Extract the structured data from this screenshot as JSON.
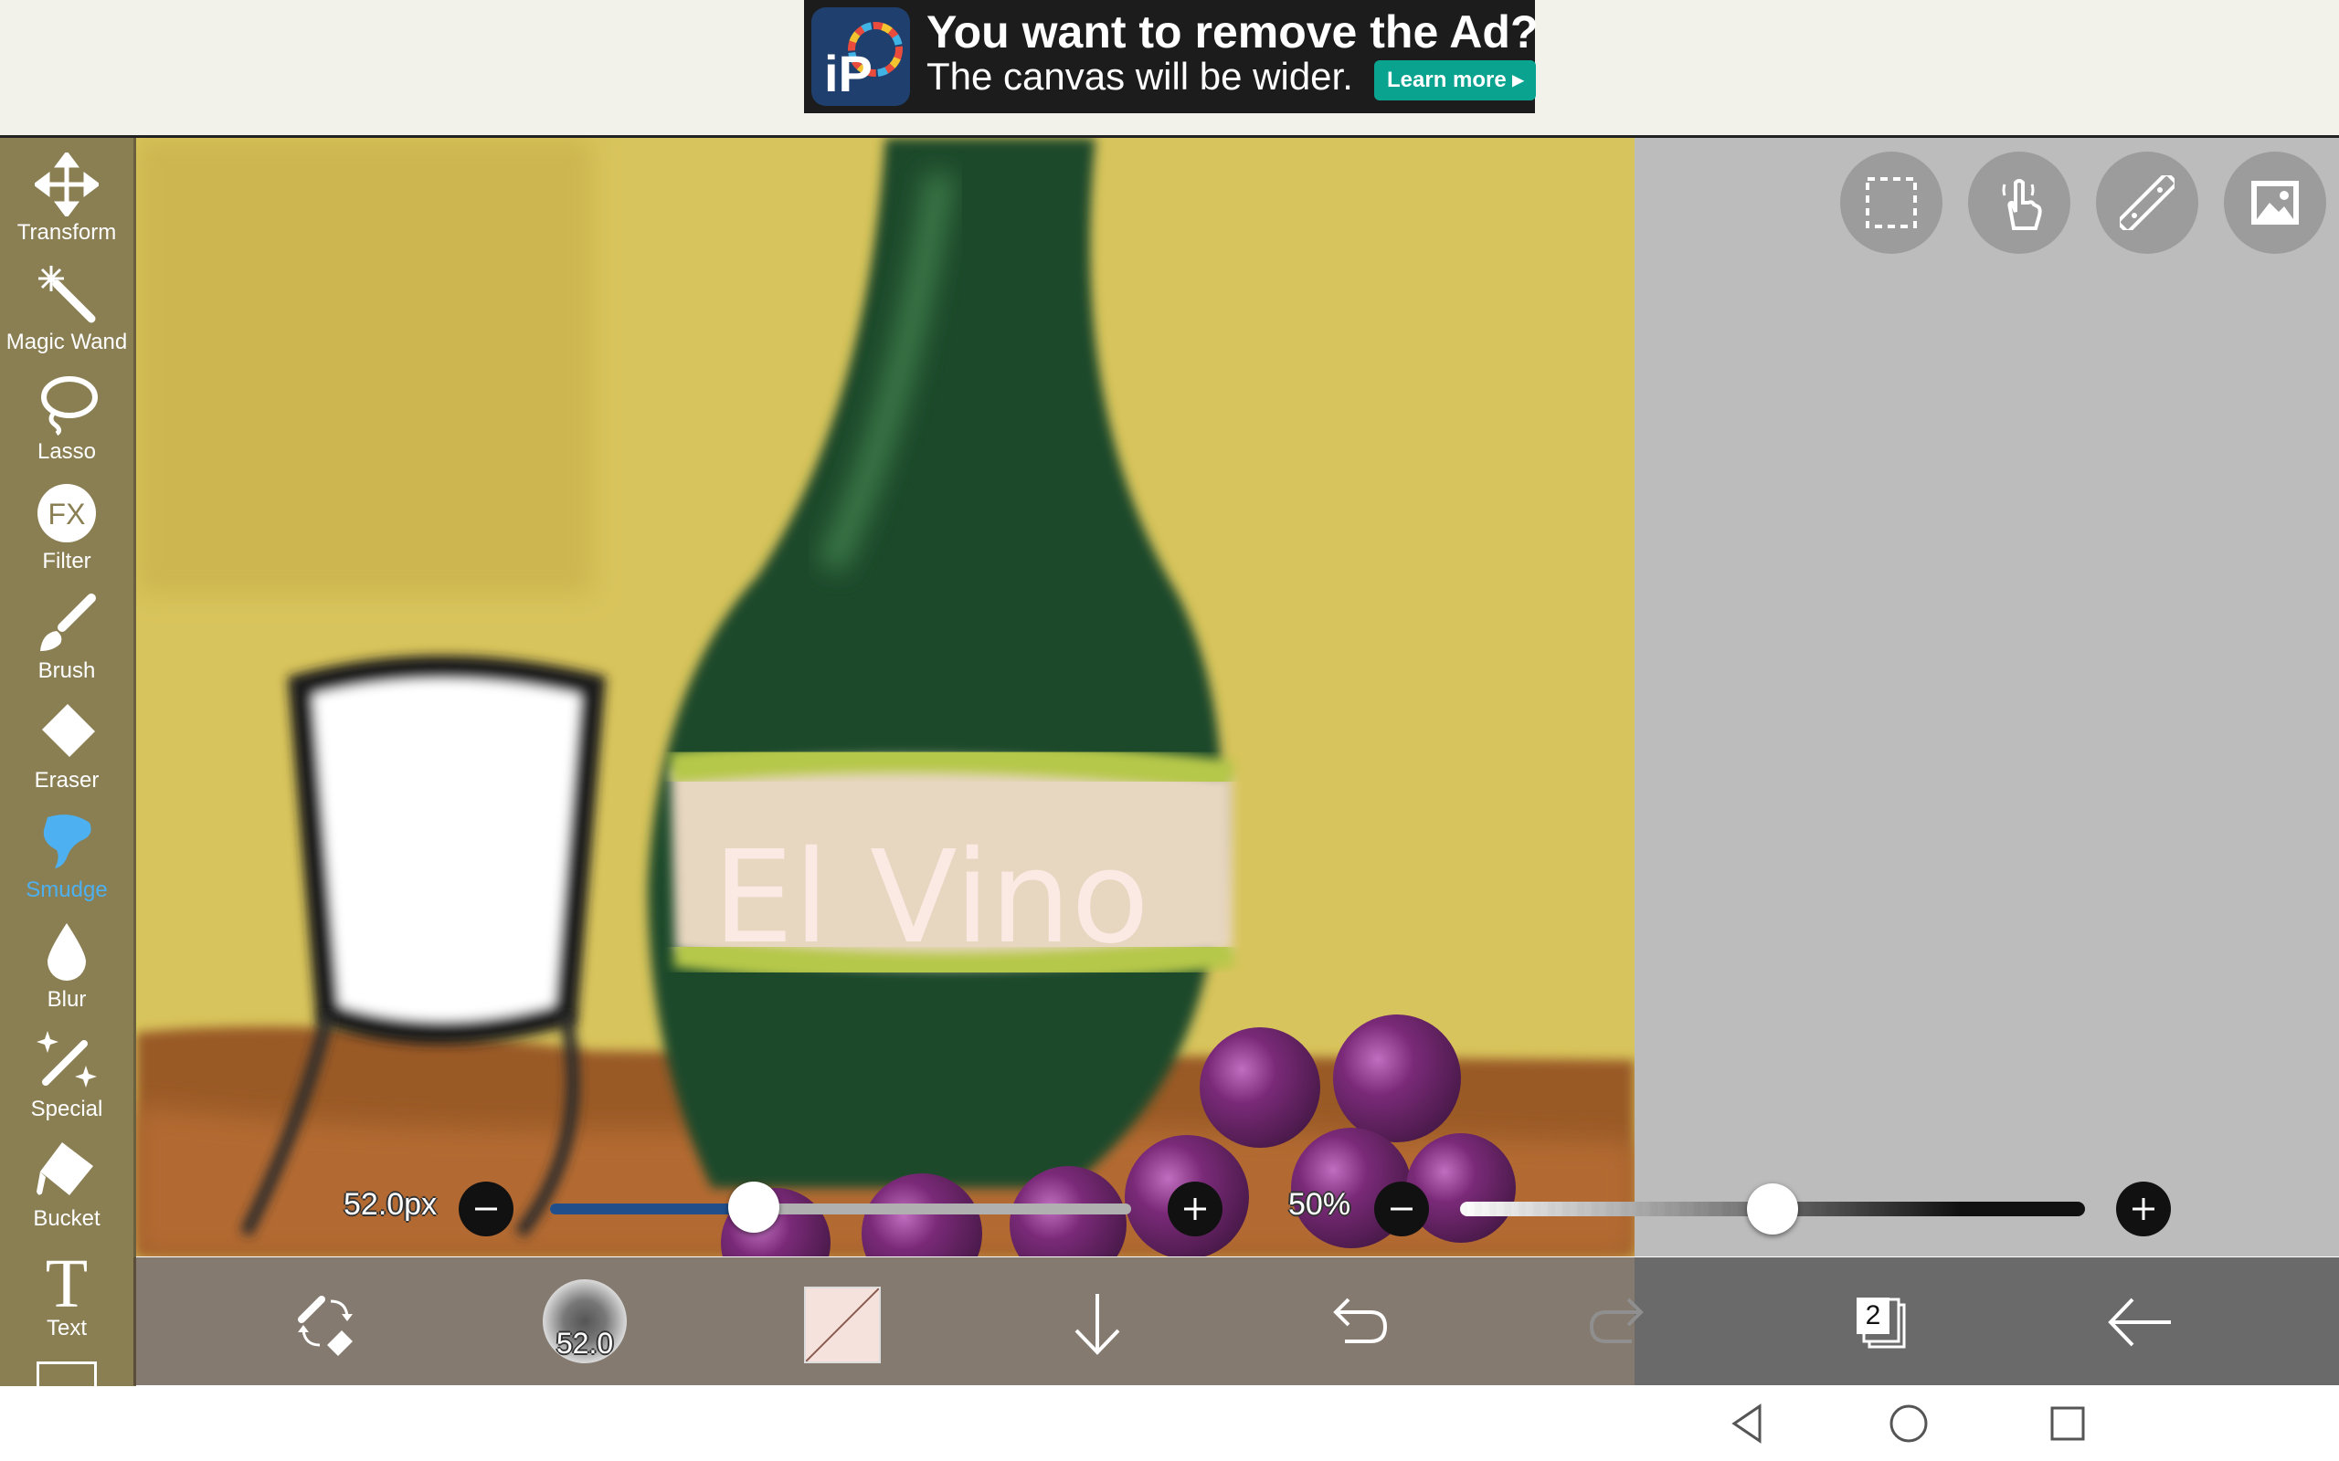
{
  "ad": {
    "title": "You want to remove the Ad?",
    "subtitle": "The canvas will be wider.",
    "button_label": "Learn more ▸",
    "logo_text": "iP"
  },
  "toolbar": {
    "tools": [
      {
        "label": "Transform",
        "icon": "transform-icon"
      },
      {
        "label": "Magic Wand",
        "icon": "magic-wand-icon"
      },
      {
        "label": "Lasso",
        "icon": "lasso-icon"
      },
      {
        "label": "Filter",
        "icon": "filter-fx-icon"
      },
      {
        "label": "Brush",
        "icon": "brush-icon"
      },
      {
        "label": "Eraser",
        "icon": "eraser-icon"
      },
      {
        "label": "Smudge",
        "icon": "smudge-icon",
        "active": true
      },
      {
        "label": "Blur",
        "icon": "blur-drop-icon"
      },
      {
        "label": "Special",
        "icon": "special-sparkle-icon"
      },
      {
        "label": "Bucket",
        "icon": "bucket-icon"
      },
      {
        "label": "Text",
        "icon": "text-icon"
      }
    ],
    "active_color": "#4db0f0"
  },
  "canvas": {
    "label_text": "El Vino"
  },
  "quick_buttons": [
    "selection-icon",
    "hand-touch-icon",
    "ruler-icon",
    "image-icon"
  ],
  "brush": {
    "size_label": "52.0px",
    "size_fraction": 0.35
  },
  "opacity": {
    "label": "50%",
    "fraction": 0.5
  },
  "bottom_bar": {
    "brush_size_text": "52.0",
    "layers_count": "2"
  },
  "colors": {
    "toolbar_bg": "#8a7e53",
    "wall_yellow": "#d8c45c",
    "bottle_green": "#1e4a2a",
    "slider_fill": "#1f4e8a",
    "gray_area": "#bcbcbc"
  }
}
